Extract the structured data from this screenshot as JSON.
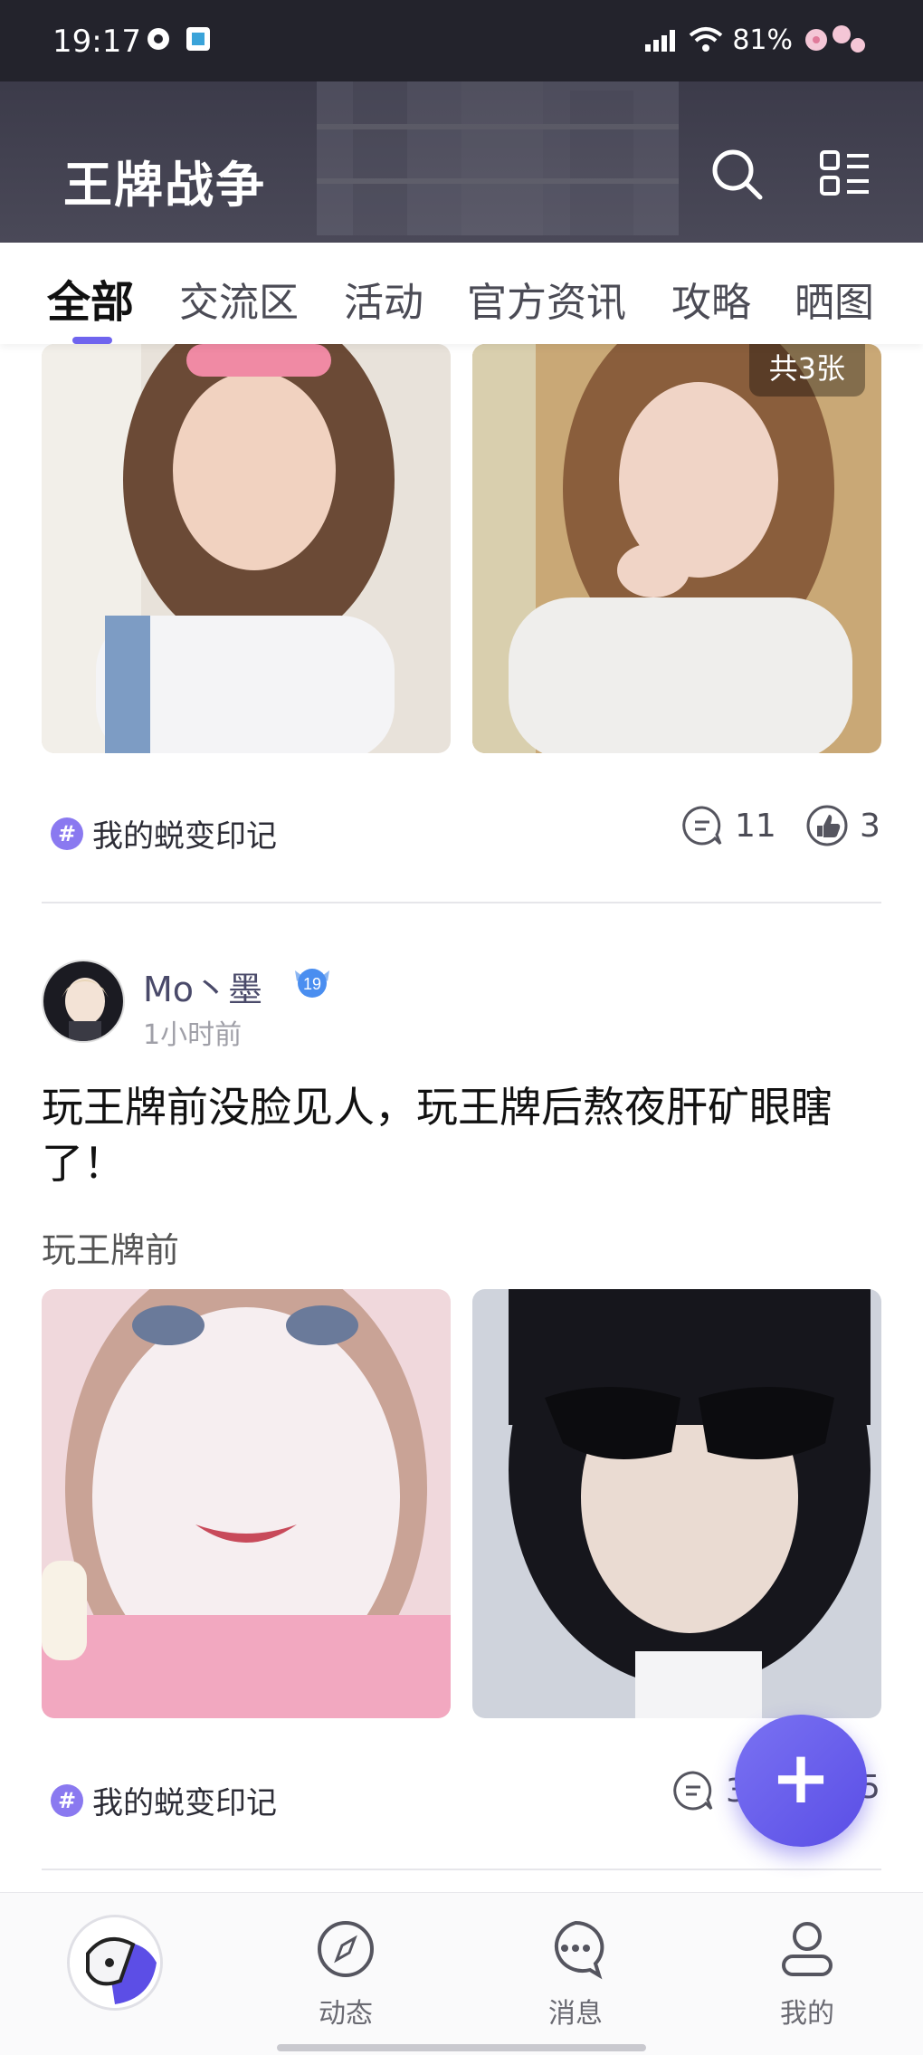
{
  "status": {
    "time": "19:17",
    "battery": "81%"
  },
  "header": {
    "title": "王牌战争"
  },
  "tabs": [
    {
      "label": "全部",
      "active": true
    },
    {
      "label": "交流区"
    },
    {
      "label": "活动"
    },
    {
      "label": "官方资讯"
    },
    {
      "label": "攻略"
    },
    {
      "label": "晒图"
    }
  ],
  "post1": {
    "image_count": "共3张",
    "tag": "我的蜕变印记",
    "comments": "11",
    "likes": "3"
  },
  "post2": {
    "author": "Mo丶墨",
    "level": "19",
    "time": "1小时前",
    "title": "玩王牌前没脸见人，玩王牌后熬夜肝矿眼瞎了！",
    "subtitle": "玩王牌前",
    "tag": "我的蜕变印记",
    "comments": "3",
    "likes": "5"
  },
  "fab": {
    "label": "+"
  },
  "nav": [
    {
      "label": "动态"
    },
    {
      "label": "消息"
    },
    {
      "label": "我的"
    }
  ],
  "colors": {
    "accent": "#6f64ee",
    "header_bg": "#3c3b4a"
  }
}
